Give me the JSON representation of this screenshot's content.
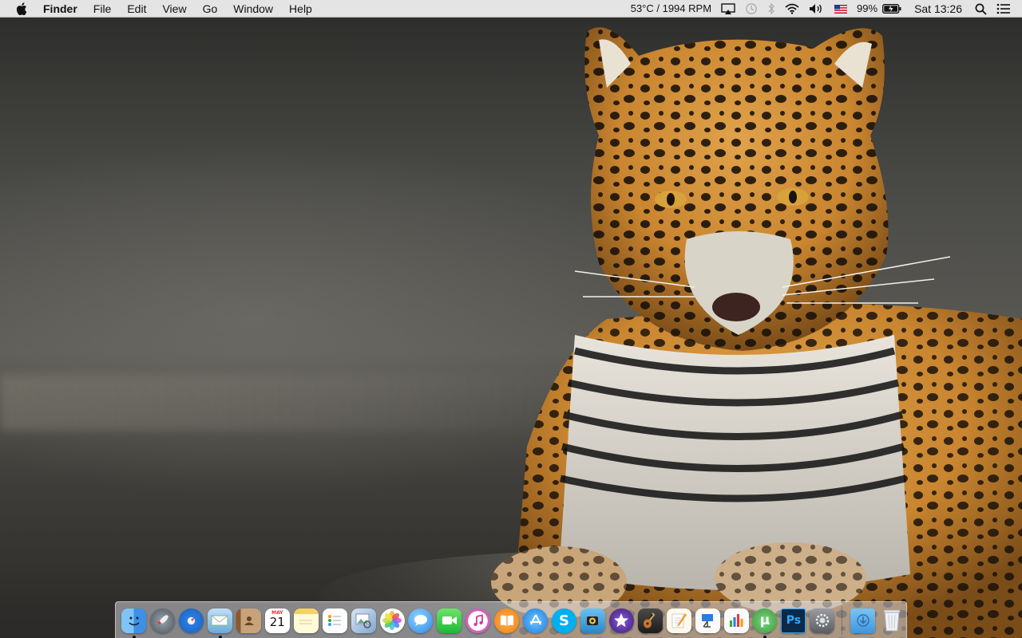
{
  "menubar": {
    "app_name": "Finder",
    "menus": [
      "File",
      "Edit",
      "View",
      "Go",
      "Window",
      "Help"
    ],
    "status": {
      "sensor": "53°C / 1994 RPM",
      "battery_percent": "99%",
      "clock": "Sat 13:26"
    },
    "status_icons": [
      "airplay-icon",
      "time-machine-icon",
      "bluetooth-icon",
      "wifi-icon",
      "volume-icon",
      "us-flag-icon",
      "battery-icon",
      "spotlight-icon",
      "notification-center-icon"
    ]
  },
  "wallpaper": {
    "subject": "jaguar"
  },
  "dock": {
    "apps": [
      {
        "name": "Finder",
        "icon": "finder-icon",
        "running": true
      },
      {
        "name": "Launchpad",
        "icon": "launchpad-icon",
        "running": false
      },
      {
        "name": "Safari",
        "icon": "safari-icon",
        "running": false
      },
      {
        "name": "Mail",
        "icon": "mail-icon",
        "running": true
      },
      {
        "name": "Contacts",
        "icon": "contacts-icon",
        "running": false
      },
      {
        "name": "Calendar",
        "icon": "calendar-icon",
        "running": false,
        "month": "MAY",
        "day": "21"
      },
      {
        "name": "Notes",
        "icon": "notes-icon",
        "running": false
      },
      {
        "name": "Reminders",
        "icon": "reminders-icon",
        "running": false
      },
      {
        "name": "Preview",
        "icon": "preview-icon",
        "running": false
      },
      {
        "name": "Photos",
        "icon": "photos-icon",
        "running": false
      },
      {
        "name": "Messages",
        "icon": "messages-icon",
        "running": false
      },
      {
        "name": "FaceTime",
        "icon": "facetime-icon",
        "running": false
      },
      {
        "name": "iTunes",
        "icon": "itunes-icon",
        "running": false
      },
      {
        "name": "iBooks",
        "icon": "ibooks-icon",
        "running": false
      },
      {
        "name": "App Store",
        "icon": "app-store-icon",
        "running": false
      },
      {
        "name": "Skype",
        "icon": "skype-icon",
        "running": false
      },
      {
        "name": "Photo Booth",
        "icon": "photo-booth-icon",
        "running": false
      },
      {
        "name": "iMovie",
        "icon": "imovie-icon",
        "running": false
      },
      {
        "name": "GarageBand",
        "icon": "garageband-icon",
        "running": false
      },
      {
        "name": "Pages",
        "icon": "pages-icon",
        "running": false
      },
      {
        "name": "Keynote",
        "icon": "keynote-icon",
        "running": false
      },
      {
        "name": "Numbers",
        "icon": "numbers-icon",
        "running": false
      },
      {
        "name": "uTorrent",
        "icon": "utorrent-icon",
        "running": true
      },
      {
        "name": "Photoshop",
        "icon": "photoshop-icon",
        "running": false
      },
      {
        "name": "System Preferences",
        "icon": "system-preferences-icon",
        "running": false
      }
    ],
    "trailing": [
      {
        "name": "Downloads",
        "icon": "downloads-folder-icon"
      },
      {
        "name": "Trash",
        "icon": "trash-icon"
      }
    ]
  },
  "colors": {
    "menubar_bg": "#ececec",
    "finder_blue": "#3f8fe6",
    "safari_blue": "#2a7de1",
    "photoshop_navy": "#0b2a4a",
    "utorrent_green": "#4caf50",
    "skype_blue": "#00aff0"
  }
}
